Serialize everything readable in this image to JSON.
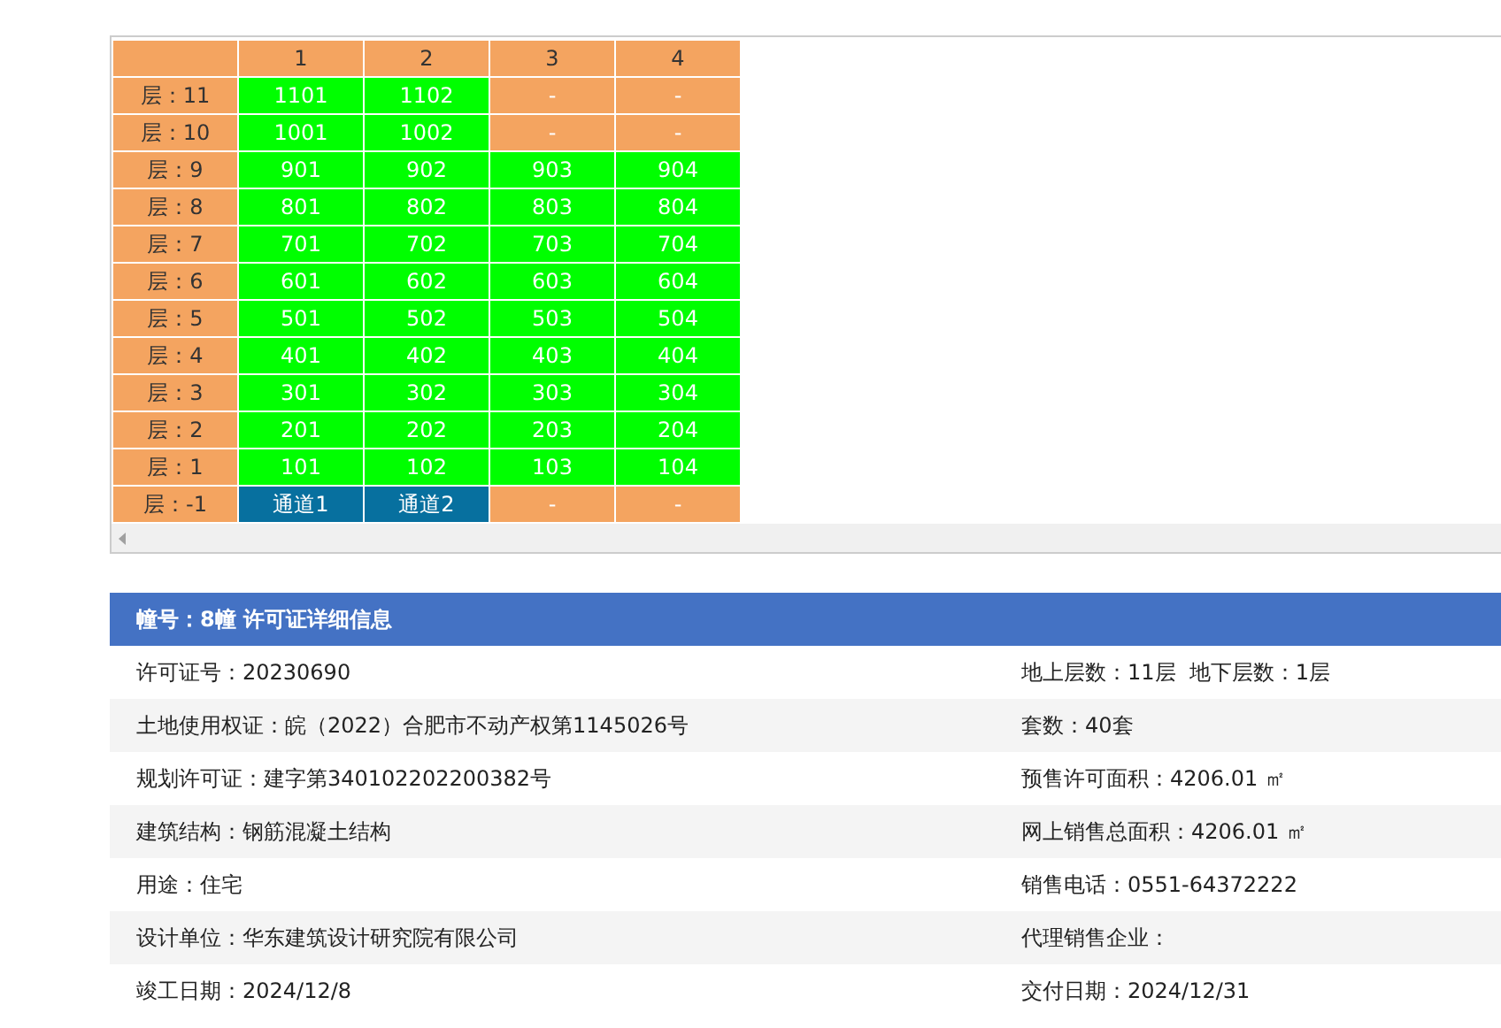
{
  "grid": {
    "columns": [
      "1",
      "2",
      "3",
      "4"
    ],
    "rows": [
      {
        "label": "层：11",
        "cells": [
          {
            "text": "1101",
            "kind": "available"
          },
          {
            "text": "1102",
            "kind": "available"
          },
          {
            "text": "-",
            "kind": "none"
          },
          {
            "text": "-",
            "kind": "none"
          }
        ]
      },
      {
        "label": "层：10",
        "cells": [
          {
            "text": "1001",
            "kind": "available"
          },
          {
            "text": "1002",
            "kind": "available"
          },
          {
            "text": "-",
            "kind": "none"
          },
          {
            "text": "-",
            "kind": "none"
          }
        ]
      },
      {
        "label": "层：9",
        "cells": [
          {
            "text": "901",
            "kind": "available"
          },
          {
            "text": "902",
            "kind": "available"
          },
          {
            "text": "903",
            "kind": "available"
          },
          {
            "text": "904",
            "kind": "available"
          }
        ]
      },
      {
        "label": "层：8",
        "cells": [
          {
            "text": "801",
            "kind": "available"
          },
          {
            "text": "802",
            "kind": "available"
          },
          {
            "text": "803",
            "kind": "available"
          },
          {
            "text": "804",
            "kind": "available"
          }
        ]
      },
      {
        "label": "层：7",
        "cells": [
          {
            "text": "701",
            "kind": "available"
          },
          {
            "text": "702",
            "kind": "available"
          },
          {
            "text": "703",
            "kind": "available"
          },
          {
            "text": "704",
            "kind": "available"
          }
        ]
      },
      {
        "label": "层：6",
        "cells": [
          {
            "text": "601",
            "kind": "available"
          },
          {
            "text": "602",
            "kind": "available"
          },
          {
            "text": "603",
            "kind": "available"
          },
          {
            "text": "604",
            "kind": "available"
          }
        ]
      },
      {
        "label": "层：5",
        "cells": [
          {
            "text": "501",
            "kind": "available"
          },
          {
            "text": "502",
            "kind": "available"
          },
          {
            "text": "503",
            "kind": "available"
          },
          {
            "text": "504",
            "kind": "available"
          }
        ]
      },
      {
        "label": "层：4",
        "cells": [
          {
            "text": "401",
            "kind": "available"
          },
          {
            "text": "402",
            "kind": "available"
          },
          {
            "text": "403",
            "kind": "available"
          },
          {
            "text": "404",
            "kind": "available"
          }
        ]
      },
      {
        "label": "层：3",
        "cells": [
          {
            "text": "301",
            "kind": "available"
          },
          {
            "text": "302",
            "kind": "available"
          },
          {
            "text": "303",
            "kind": "available"
          },
          {
            "text": "304",
            "kind": "available"
          }
        ]
      },
      {
        "label": "层：2",
        "cells": [
          {
            "text": "201",
            "kind": "available"
          },
          {
            "text": "202",
            "kind": "available"
          },
          {
            "text": "203",
            "kind": "available"
          },
          {
            "text": "204",
            "kind": "available"
          }
        ]
      },
      {
        "label": "层：1",
        "cells": [
          {
            "text": "101",
            "kind": "available"
          },
          {
            "text": "102",
            "kind": "available"
          },
          {
            "text": "103",
            "kind": "available"
          },
          {
            "text": "104",
            "kind": "available"
          }
        ]
      },
      {
        "label": "层：-1",
        "cells": [
          {
            "text": "通道1",
            "kind": "passage"
          },
          {
            "text": "通道2",
            "kind": "passage"
          },
          {
            "text": "-",
            "kind": "none"
          },
          {
            "text": "-",
            "kind": "none"
          }
        ]
      }
    ]
  },
  "details": {
    "title": "幢号：8幢 许可证详细信息",
    "rows": [
      [
        "许可证号：20230690",
        "地上层数：11层  地下层数：1层"
      ],
      [
        "土地使用权证：皖（2022）合肥市不动产权第1145026号",
        "套数：40套"
      ],
      [
        "规划许可证：建字第340102202200382号",
        "预售许可面积：4206.01 ㎡"
      ],
      [
        "建筑结构：钢筋混凝土结构",
        "网上销售总面积：4206.01 ㎡"
      ],
      [
        "用途：住宅",
        "销售电话：0551-64372222"
      ],
      [
        "设计单位：华东建筑设计研究院有限公司",
        "代理销售企业："
      ],
      [
        "竣工日期：2024/12/8",
        "交付日期：2024/12/31"
      ]
    ]
  }
}
